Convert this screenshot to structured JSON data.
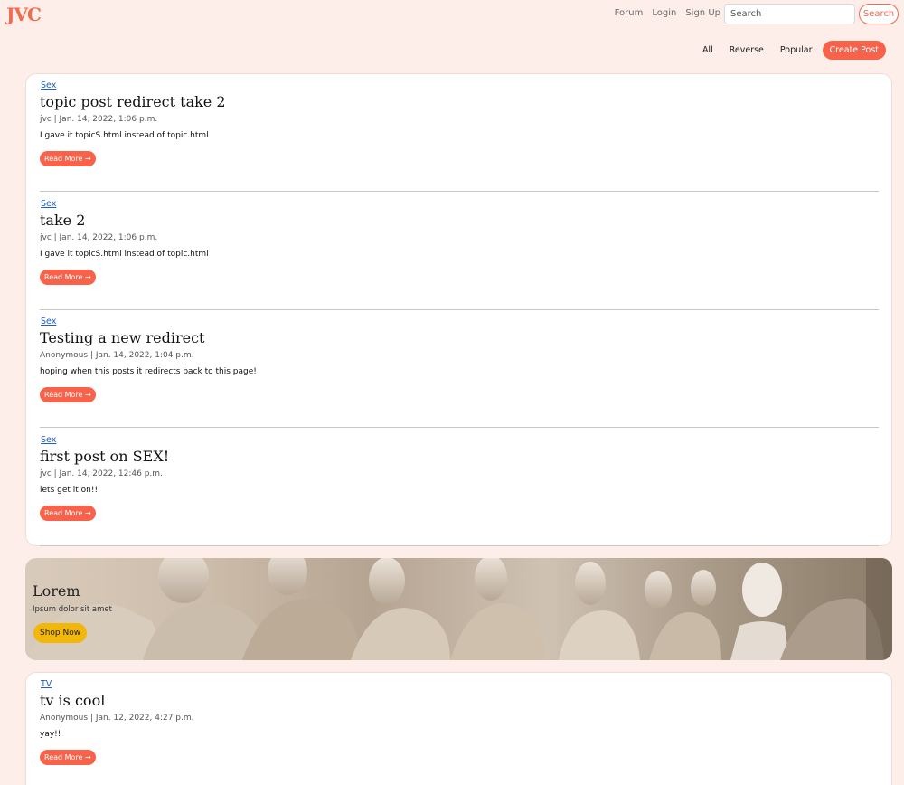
{
  "header": {
    "logo": "JVC",
    "nav": [
      "Forum",
      "Login",
      "Sign Up"
    ],
    "search_placeholder": "Search",
    "search_button": "Search"
  },
  "filters": {
    "all": "All",
    "reverse": "Reverse",
    "popular": "Popular",
    "create_post": "Create Post"
  },
  "posts": [
    {
      "topic": "Sex",
      "title": "topic post redirect take 2",
      "meta": "jvc | Jan. 14, 2022, 1:06 p.m.",
      "body": "I gave it topicS.html instead of topic.html",
      "cta": "Read More →"
    },
    {
      "topic": "Sex",
      "title": "take 2",
      "meta": "jvc | Jan. 14, 2022, 1:06 p.m.",
      "body": "I gave it topicS.html instead of topic.html",
      "cta": "Read More →"
    },
    {
      "topic": "Sex",
      "title": "Testing a new redirect",
      "meta": "Anonymous | Jan. 14, 2022, 1:04 p.m.",
      "body": "hoping when this posts it redirects back to this page!",
      "cta": "Read More →"
    },
    {
      "topic": "Sex",
      "title": "first post on SEX!",
      "meta": "jvc | Jan. 14, 2022, 12:46 p.m.",
      "body": "lets get it on!!",
      "cta": "Read More →"
    }
  ],
  "banner": {
    "title": "Lorem",
    "subtitle": "Ipsum dolor sit amet",
    "button": "Shop Now"
  },
  "tv_post": {
    "topic": "TV",
    "title": "tv is cool",
    "meta": "Anonymous | Jan. 12, 2022, 4:27 p.m.",
    "body": "yay!!",
    "cta": "Read More →"
  },
  "colors": {
    "accent": "#f8624a",
    "background": "#fdeee9",
    "link": "#1d5fd1",
    "banner_button": "#f3b70a"
  }
}
